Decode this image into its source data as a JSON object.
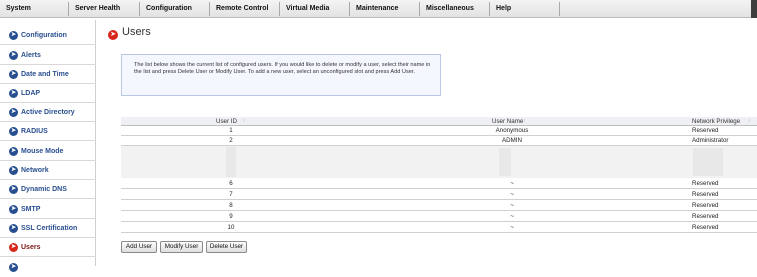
{
  "top_menu": [
    "System",
    "Server Health",
    "Configuration",
    "Remote Control",
    "Virtual Media",
    "Maintenance",
    "Miscellaneous",
    "Help"
  ],
  "sidebar": {
    "items": [
      {
        "label": "Configuration",
        "active": false
      },
      {
        "label": "Alerts",
        "active": false
      },
      {
        "label": "Date and Time",
        "active": false
      },
      {
        "label": "LDAP",
        "active": false
      },
      {
        "label": "Active Directory",
        "active": false
      },
      {
        "label": "RADIUS",
        "active": false
      },
      {
        "label": "Mouse Mode",
        "active": false
      },
      {
        "label": "Network",
        "active": false
      },
      {
        "label": "Dynamic DNS",
        "active": false
      },
      {
        "label": "SMTP",
        "active": false
      },
      {
        "label": "SSL Certification",
        "active": false
      },
      {
        "label": "Users",
        "active": true
      }
    ]
  },
  "page": {
    "title": "Users",
    "info": "The list below shows the current list of configured users. If you would like to delete or modify a user, select their name in the list and press Delete User or Modify User. To add a new user, select an unconfigured slot and press Add User."
  },
  "table": {
    "columns": [
      "User ID",
      "User Name",
      "Network Privilege"
    ],
    "sort_glyph": "↕",
    "rows": [
      {
        "id": "1",
        "name": "Anonymous",
        "privilege": "Reserved"
      },
      {
        "id": "2",
        "name": "ADMIN",
        "privilege": "Administrator"
      },
      {
        "id": "6",
        "name": "~",
        "privilege": "Reserved"
      },
      {
        "id": "7",
        "name": "~",
        "privilege": "Reserved"
      },
      {
        "id": "8",
        "name": "~",
        "privilege": "Reserved"
      },
      {
        "id": "9",
        "name": "~",
        "privilege": "Reserved"
      },
      {
        "id": "10",
        "name": "~",
        "privilege": "Reserved"
      }
    ]
  },
  "buttons": {
    "add": "Add User",
    "modify": "Modify User",
    "delete": "Delete User"
  },
  "icons": {
    "nav": "arrow-circle-icon"
  },
  "colors": {
    "accent": "#d9261c",
    "nav_text": "#2a4f8f",
    "info_bg": "#f4f7fd"
  }
}
